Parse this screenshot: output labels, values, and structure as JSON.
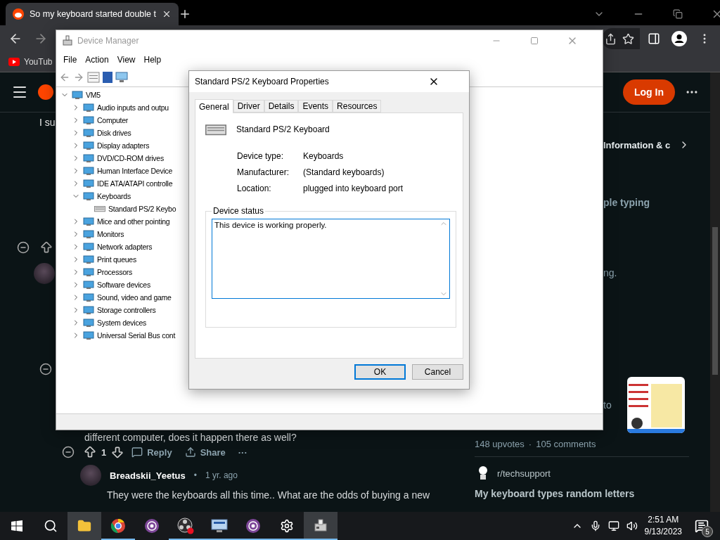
{
  "browser": {
    "tab": {
      "title": "So my keyboard started double t"
    },
    "bookmarks": [
      {
        "label": "YouTub"
      }
    ]
  },
  "reddit": {
    "login_button": "Log In",
    "post_text": "I su",
    "sidebar_link": "Information & c",
    "related_fragments": [
      "ple typing",
      "ng.",
      "to"
    ],
    "related_upvotes": "148 upvotes",
    "related_separator": "·",
    "related_comments": "105 comments",
    "related_community": "r/techsupport",
    "related_title": "My keyboard types random letters",
    "comment_tail": "different computer, does it happen there as well?",
    "comment_actions": {
      "votes": "1",
      "reply": "Reply",
      "share": "Share",
      "more": "···"
    },
    "reply": {
      "author": "Breadskii_Yeetus",
      "separator": "•",
      "age": "1 yr. ago",
      "text": "They were the keyboards all this time.. What are the odds of buying a new"
    }
  },
  "device_manager": {
    "title": "Device Manager",
    "active": false,
    "menu": [
      "File",
      "Action",
      "View",
      "Help"
    ],
    "tree": {
      "label": "VM5",
      "expanded": true,
      "children": [
        {
          "label": "Audio inputs and outpu",
          "expanded": false
        },
        {
          "label": "Computer",
          "expanded": false
        },
        {
          "label": "Disk drives",
          "expanded": false
        },
        {
          "label": "Display adapters",
          "expanded": false
        },
        {
          "label": "DVD/CD-ROM drives",
          "expanded": false
        },
        {
          "label": "Human Interface Device",
          "expanded": false
        },
        {
          "label": "IDE ATA/ATAPI controlle",
          "expanded": false
        },
        {
          "label": "Keyboards",
          "expanded": true,
          "children": [
            {
              "label": "Standard PS/2 Keybo"
            }
          ]
        },
        {
          "label": "Mice and other pointing",
          "expanded": false
        },
        {
          "label": "Monitors",
          "expanded": false
        },
        {
          "label": "Network adapters",
          "expanded": false
        },
        {
          "label": "Print queues",
          "expanded": false
        },
        {
          "label": "Processors",
          "expanded": false
        },
        {
          "label": "Software devices",
          "expanded": false
        },
        {
          "label": "Sound, video and game",
          "expanded": false
        },
        {
          "label": "Storage controllers",
          "expanded": false
        },
        {
          "label": "System devices",
          "expanded": false
        },
        {
          "label": "Universal Serial Bus cont",
          "expanded": false
        }
      ]
    }
  },
  "properties_dialog": {
    "title": "Standard PS/2 Keyboard Properties",
    "tabs": [
      {
        "label": "General",
        "selected": true
      },
      {
        "label": "Driver",
        "selected": false
      },
      {
        "label": "Details",
        "selected": false
      },
      {
        "label": "Events",
        "selected": false
      },
      {
        "label": "Resources",
        "selected": false
      }
    ],
    "device_name": "Standard PS/2 Keyboard",
    "properties": [
      {
        "label": "Device type:",
        "value": "Keyboards"
      },
      {
        "label": "Manufacturer:",
        "value": "(Standard keyboards)"
      },
      {
        "label": "Location:",
        "value": "plugged into keyboard port"
      }
    ],
    "status_group": {
      "title": "Device status",
      "text": "This device is working properly."
    },
    "buttons": [
      {
        "label": "OK",
        "default": true
      },
      {
        "label": "Cancel",
        "default": false
      }
    ]
  },
  "taskbar": {
    "apps": [
      {
        "open": false,
        "highlighted": true
      },
      {
        "open": true,
        "highlighted": false
      },
      {
        "open": false,
        "highlighted": false
      },
      {
        "open": true,
        "highlighted": false
      },
      {
        "open": true,
        "highlighted": false
      },
      {
        "open": true,
        "highlighted": false
      },
      {
        "open": true,
        "highlighted": false
      },
      {
        "open": true,
        "highlighted": true
      }
    ],
    "time": "2:51 AM",
    "date": "9/13/2023",
    "notifications": "5"
  }
}
